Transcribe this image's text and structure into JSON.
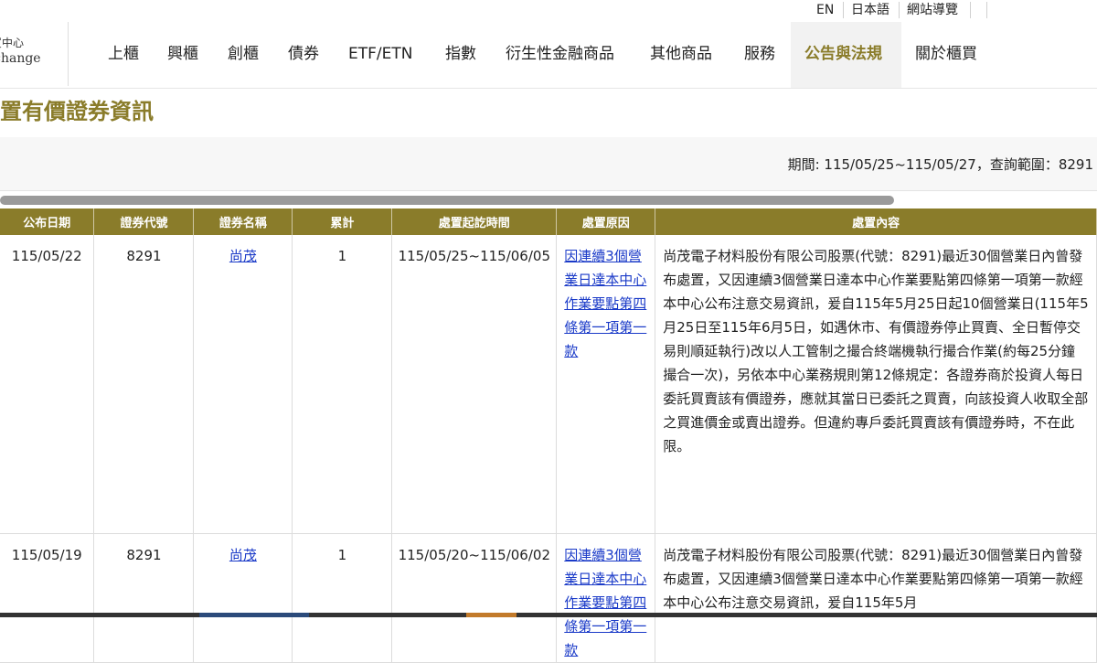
{
  "topbar": {
    "links": [
      "EN",
      "日本語",
      "網站導覽"
    ]
  },
  "logo": {
    "line1": "櫃買中心",
    "line2": "Exchange"
  },
  "nav": {
    "items": [
      "上櫃",
      "興櫃",
      "創櫃",
      "債券",
      "ETF/ETN",
      "指數",
      "衍生性金融商品",
      "其他商品",
      "服務",
      "公告與法規",
      "關於櫃買"
    ],
    "active": "公告與法規"
  },
  "page": {
    "title": "處置有價證券資訊"
  },
  "query": {
    "text": "期間: 115/05/25~115/05/27，查詢範圍：8291"
  },
  "table": {
    "headers": [
      "公布日期",
      "證券代號",
      "證券名稱",
      "累計",
      "處置起訖時間",
      "處置原因",
      "處置內容"
    ],
    "rows": [
      {
        "date": "115/05/22",
        "code": "8291",
        "name": "尚茂",
        "count": "1",
        "period": "115/05/25~115/06/05",
        "reason": "因連續3個營業日達本中心作業要點第四條第一項第一款",
        "content": "尚茂電子材料股份有限公司股票(代號：8291)最近30個營業日內曾發布處置，又因連續3個營業日達本中心作業要點第四條第一項第一款經本中心公布注意交易資訊，爰自115年5月25日起10個營業日(115年5月25日至115年6月5日，如遇休市、有價證券停止買賣、全日暫停交易則順延執行)改以人工管制之撮合終端機執行撮合作業(約每25分鐘撮合一次)，另依本中心業務規則第12條規定：各證券商於投資人每日委託買賣該有價證券，應就其當日已委託之買賣，向該投資人收取全部之買進價金或賣出證券。但違約專戶委託買賣該有價證券時，不在此限。"
      },
      {
        "date": "115/05/19",
        "code": "8291",
        "name": "尚茂",
        "count": "1",
        "period": "115/05/20~115/06/02",
        "reason": "因連續3個營業日達本中心作業要點第四條第一項第一款",
        "content": "尚茂電子材料股份有限公司股票(代號：8291)最近30個營業日內曾發布處置，又因連續3個營業日達本中心作業要點第四條第一項第一款經本中心公布注意交易資訊，爰自115年5月"
      }
    ]
  },
  "colors": {
    "accent": "#8a7c2a",
    "link": "#1a3ac8",
    "header_text": "#ffffff"
  }
}
